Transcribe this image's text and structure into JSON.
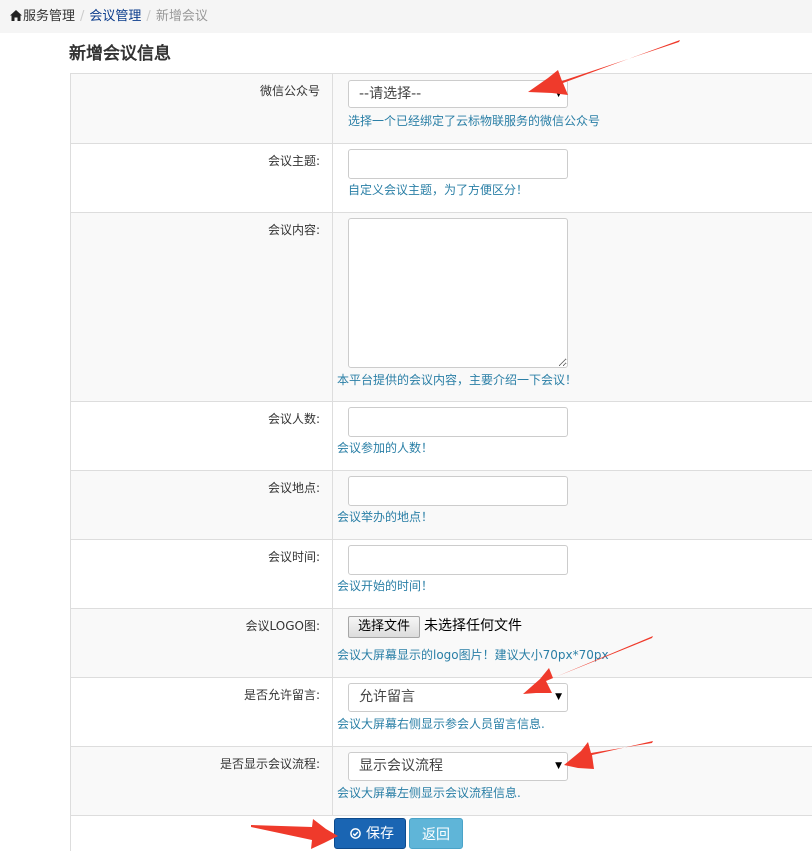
{
  "breadcrumb": {
    "items": [
      "服务管理",
      "会议管理",
      "新增会议"
    ],
    "separator": "/"
  },
  "page": {
    "title": "新增会议信息"
  },
  "form": {
    "wechat_account": {
      "label": "微信公众号",
      "value": "--请选择--",
      "hint": "选择一个已经绑定了云标物联服务的微信公众号"
    },
    "topic": {
      "label": "会议主题:",
      "value": "",
      "hint": "自定义会议主题，为了方便区分！"
    },
    "content": {
      "label": "会议内容:",
      "value": "",
      "hint": "本平台提供的会议内容，主要介绍一下会议！"
    },
    "attendees": {
      "label": "会议人数:",
      "value": "",
      "hint": "会议参加的人数！"
    },
    "location": {
      "label": "会议地点:",
      "value": "",
      "hint": "会议举办的地点！"
    },
    "time": {
      "label": "会议时间:",
      "value": "",
      "hint": "会议开始的时间！"
    },
    "logo": {
      "label": "会议LOGO图:",
      "button": "选择文件",
      "status": "未选择任何文件",
      "hint": "会议大屏幕显示的logo图片！建议大小70px*70px"
    },
    "allow_comments": {
      "label": "是否允许留言:",
      "value": "允许留言",
      "hint": "会议大屏幕右侧显示参会人员留言信息."
    },
    "show_agenda": {
      "label": "是否显示会议流程:",
      "value": "显示会议流程",
      "hint": "会议大屏幕左侧显示会议流程信息."
    }
  },
  "actions": {
    "save": "保存",
    "back": "返回"
  },
  "colors": {
    "hint": "#2a7fa6",
    "save_button": "#1a65b3",
    "back_button": "#5fb5d8",
    "annotation_arrow": "#ef3a2b"
  },
  "icons": {
    "home": "home-icon",
    "save": "check-circle-icon"
  }
}
